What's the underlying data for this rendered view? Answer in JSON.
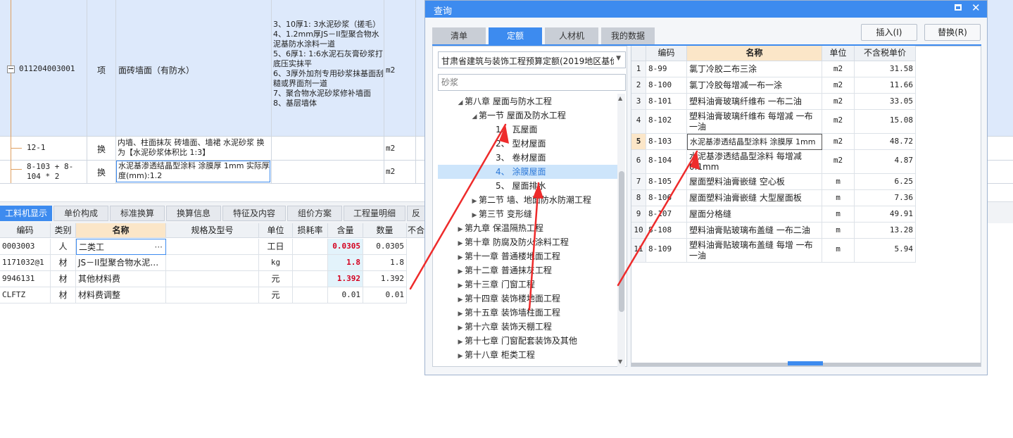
{
  "top_table": {
    "row1": {
      "code": "011204003001",
      "type": "项",
      "name": "面砖墙面（有防水）",
      "features": "3、10厚1: 3水泥砂浆（搓毛）\n4、1.2mm厚JS－II型聚合物水泥基防水涂料一道\n5、6厚1: 1:6水泥石灰膏砂浆打底压实抹平\n6、3厚外加剂专用砂浆抹基面刮糙或界面剂一道\n7、聚合物水泥砂浆修补墙面\n8、基层墙体",
      "unit": "m2"
    },
    "row2": {
      "code": "12-1",
      "type": "换",
      "name": "内墙、柱面抹灰 砖墙面、墙裙 水泥砂浆 换为【水泥砂浆体积比 1:3】",
      "unit": "m2"
    },
    "row3": {
      "code": "8-103 + 8-104 * 2",
      "type": "换",
      "name": "水泥基渗透结晶型涂料 涂膜厚 1mm 实际厚度(mm):1.2",
      "unit": "m2"
    }
  },
  "bottom_tabs": [
    "工料机显示",
    "单价构成",
    "标准换算",
    "换算信息",
    "特征及内容",
    "组价方案",
    "工程量明细",
    "反"
  ],
  "bottom_table": {
    "headers": [
      "编码",
      "类别",
      "名称",
      "规格及型号",
      "单位",
      "损耗率",
      "含量",
      "数量",
      "不合"
    ],
    "rows": [
      {
        "code": "0003003",
        "cat": "人",
        "name": "二类工",
        "unit": "工日",
        "content": "0.0305",
        "qty": "0.0305",
        "ellipsis": "···"
      },
      {
        "code": "1171032@1",
        "cat": "材",
        "name": "JS－II型聚合物水泥…",
        "unit": "kg",
        "content": "1.8",
        "qty": "1.8"
      },
      {
        "code": "9946131",
        "cat": "材",
        "name": "其他材料费",
        "unit": "元",
        "content": "1.392",
        "qty": "1.392"
      },
      {
        "code": "CLFTZ",
        "cat": "材",
        "name": "材料费调整",
        "unit": "元",
        "content": "0.01",
        "qty": "0.01"
      }
    ]
  },
  "dialog": {
    "title": "查询",
    "tabs": [
      "清单",
      "定额",
      "人材机",
      "我的数据"
    ],
    "insert_btn": "插入(I)",
    "replace_btn": "替换(R)",
    "dataset": "甘肃省建筑与装饰工程预算定额(2019地区基价",
    "search_placeholder": "砂浆",
    "tree": [
      {
        "label": "第八章 屋面与防水工程",
        "arrow": "◢"
      },
      {
        "label": "第一节 屋面及防水工程",
        "arrow": "◢"
      },
      {
        "label": "1、 瓦屋面",
        "arrow": ""
      },
      {
        "label": "2、 型材屋面",
        "arrow": ""
      },
      {
        "label": "3、 卷材屋面",
        "arrow": ""
      },
      {
        "label": "4、 涂膜屋面",
        "arrow": ""
      },
      {
        "label": "5、 屋面排水",
        "arrow": ""
      },
      {
        "label": "第二节 墙、地面防水防潮工程",
        "arrow": "▶"
      },
      {
        "label": "第三节 变形缝",
        "arrow": "▶"
      },
      {
        "label": "第九章 保温隔热工程",
        "arrow": "▶"
      },
      {
        "label": "第十章 防腐及防火涂料工程",
        "arrow": "▶"
      },
      {
        "label": "第十一章 普通楼地面工程",
        "arrow": "▶"
      },
      {
        "label": "第十二章 普通抹灰工程",
        "arrow": "▶"
      },
      {
        "label": "第十三章 门窗工程",
        "arrow": "▶"
      },
      {
        "label": "第十四章 装饰楼地面工程",
        "arrow": "▶"
      },
      {
        "label": "第十五章 装饰墙柱面工程",
        "arrow": "▶"
      },
      {
        "label": "第十六章 装饰天棚工程",
        "arrow": "▶"
      },
      {
        "label": "第十七章 门窗配套装饰及其他",
        "arrow": "▶"
      },
      {
        "label": "第十八章 柜类工程",
        "arrow": "▶"
      }
    ],
    "grid_headers": [
      "编码",
      "名称",
      "单位",
      "不含税单价"
    ],
    "grid_rows": [
      {
        "n": "1",
        "code": "8-99",
        "name": "氯丁冷胶二布三涂",
        "unit": "m2",
        "price": "31.58"
      },
      {
        "n": "2",
        "code": "8-100",
        "name": "氯丁冷胶每增减一布一涂",
        "unit": "m2",
        "price": "11.66"
      },
      {
        "n": "3",
        "code": "8-101",
        "name": "塑料油膏玻璃纤维布 一布二油",
        "unit": "m2",
        "price": "33.05"
      },
      {
        "n": "4",
        "code": "8-102",
        "name": "塑料油膏玻璃纤维布 每增减 一布一油",
        "unit": "m2",
        "price": "15.08"
      },
      {
        "n": "5",
        "code": "8-103",
        "name": "水泥基渗透结晶型涂料 涂膜厚 1mm",
        "unit": "m2",
        "price": "48.72"
      },
      {
        "n": "6",
        "code": "8-104",
        "name": "水泥基渗透结晶型涂料 每增减 0.1mm",
        "unit": "m2",
        "price": "4.87"
      },
      {
        "n": "7",
        "code": "8-105",
        "name": "屋面塑料油膏嵌缝 空心板",
        "unit": "m",
        "price": "6.25"
      },
      {
        "n": "8",
        "code": "8-106",
        "name": "屋面塑料油膏嵌缝 大型屋面板",
        "unit": "m",
        "price": "7.36"
      },
      {
        "n": "9",
        "code": "8-107",
        "name": "屋面分格缝",
        "unit": "m",
        "price": "49.91"
      },
      {
        "n": "10",
        "code": "8-108",
        "name": "塑料油膏贴玻璃布盖缝 一布二油",
        "unit": "m",
        "price": "13.28"
      },
      {
        "n": "11",
        "code": "8-109",
        "name": "塑料油膏贴玻璃布盖缝 每增 一布一油",
        "unit": "m",
        "price": "5.94"
      }
    ]
  },
  "colors": {
    "accent": "#3d8bef",
    "annotation": "#ee2b2b",
    "selection": "#dde9fb"
  }
}
